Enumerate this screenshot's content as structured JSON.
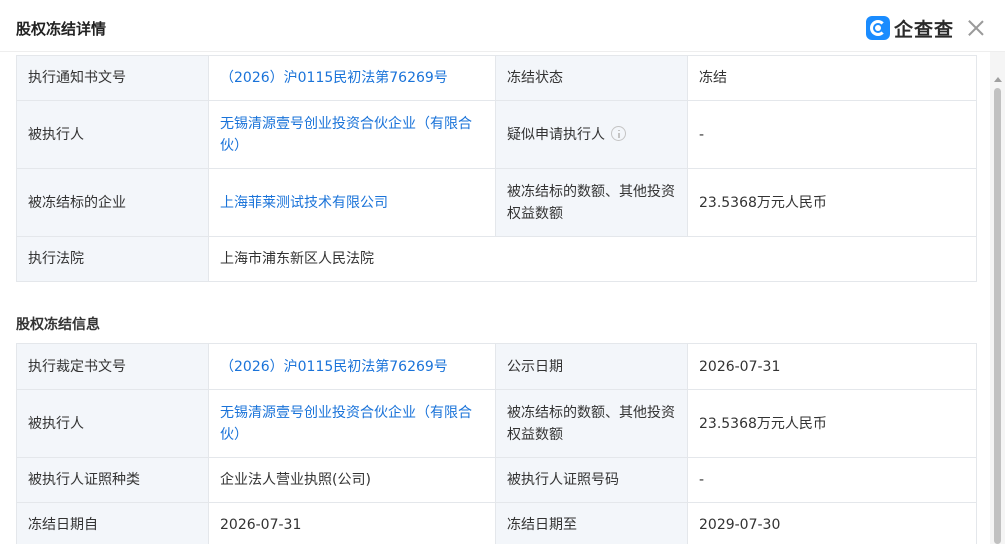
{
  "dialog": {
    "title": "股权冻结详情",
    "logo_text": "企查查"
  },
  "detail_table": {
    "rows": [
      {
        "k1": "执行通知书文号",
        "v1": "（2026）沪0115民初法第76269号",
        "k2": "冻结状态",
        "v2": "冻结"
      },
      {
        "k1": "被执行人",
        "v1": "无锡清源壹号创业投资合伙企业（有限合伙）",
        "k2": "疑似申请执行人",
        "v2": "-"
      },
      {
        "k1": "被冻结标的企业",
        "v1": "上海菲莱测试技术有限公司",
        "k2": "被冻结标的数额、其他投资权益数额",
        "v2": "23.5368万元人民币"
      },
      {
        "k1": "执行法院",
        "v1": "上海市浦东新区人民法院"
      }
    ]
  },
  "freeze_info": {
    "title": "股权冻结信息",
    "rows": [
      {
        "k1": "执行裁定书文号",
        "v1": "（2026）沪0115民初法第76269号",
        "k2": "公示日期",
        "v2": "2026-07-31"
      },
      {
        "k1": "被执行人",
        "v1": "无锡清源壹号创业投资合伙企业（有限合伙）",
        "k2": "被冻结标的数额、其他投资权益数额",
        "v2": "23.5368万元人民币"
      },
      {
        "k1": "被执行人证照种类",
        "v1": "企业法人营业执照(公司)",
        "k2": "被执行人证照号码",
        "v2": "-"
      },
      {
        "k1": "冻结日期自",
        "v1": "2026-07-31",
        "k2": "冻结日期至",
        "v2": "2029-07-30"
      }
    ]
  },
  "colors": {
    "link": "#1a73d9",
    "key_cell_bg": "#f3f6fa",
    "border": "#e4e7eb",
    "logo_blue": "#1a8cff"
  }
}
